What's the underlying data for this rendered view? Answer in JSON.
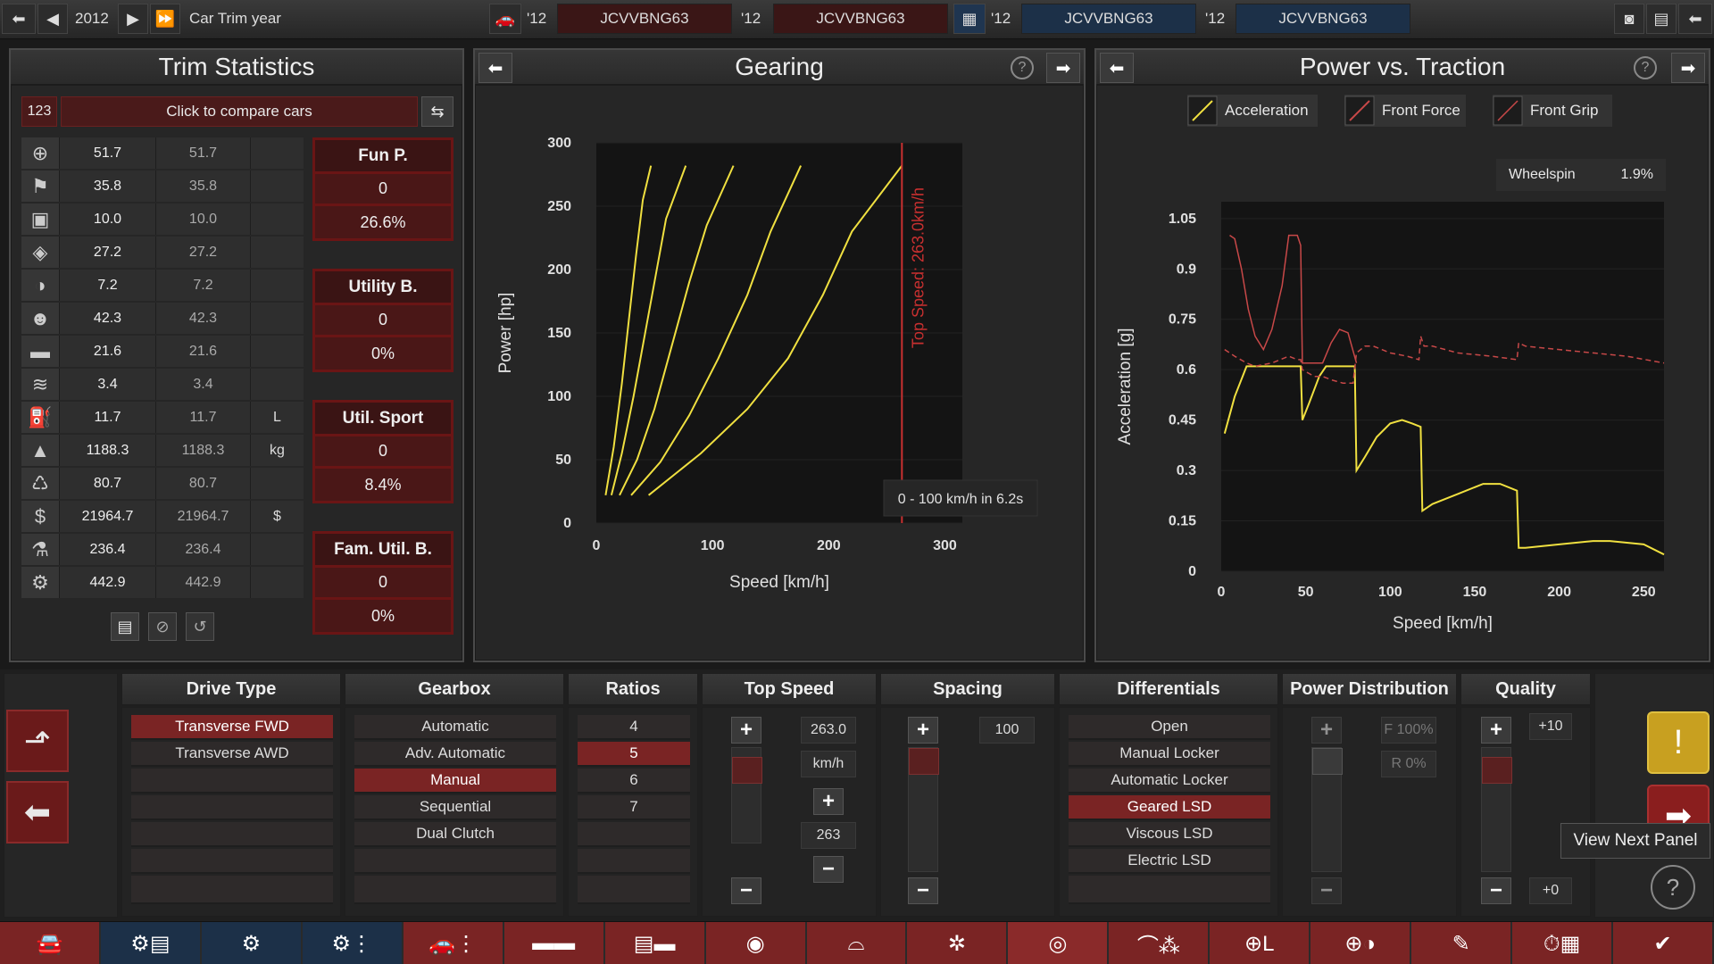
{
  "topbar": {
    "year": "2012",
    "trim_label": "Car Trim year",
    "cars": [
      {
        "year": "'12",
        "name": "JCVVBNG63"
      },
      {
        "year": "'12",
        "name": "JCVVBNG63"
      },
      {
        "year": "'12",
        "name": "JCVVBNG63"
      },
      {
        "year": "'12",
        "name": "JCVVBNG63"
      }
    ]
  },
  "trim_stats": {
    "title": "Trim Statistics",
    "id_label": "123",
    "compare_label": "Click to compare cars",
    "rows": [
      {
        "icon": "steering-wheel-icon",
        "glyph": "⊕",
        "v1": "51.7",
        "v2": "51.7",
        "unit": ""
      },
      {
        "icon": "race-flag-icon",
        "glyph": "⚑",
        "v1": "35.8",
        "v2": "35.8",
        "unit": ""
      },
      {
        "icon": "seat-icon",
        "glyph": "▣",
        "v1": "10.0",
        "v2": "10.0",
        "unit": ""
      },
      {
        "icon": "shield-icon",
        "glyph": "◈",
        "v1": "27.2",
        "v2": "27.2",
        "unit": ""
      },
      {
        "icon": "prestige-icon",
        "glyph": "◑",
        "v1": "7.2",
        "v2": "7.2",
        "unit": ""
      },
      {
        "icon": "passengers-icon",
        "glyph": "☻",
        "v1": "42.3",
        "v2": "42.3",
        "unit": ""
      },
      {
        "icon": "cargo-icon",
        "glyph": "▬",
        "v1": "21.6",
        "v2": "21.6",
        "unit": ""
      },
      {
        "icon": "offroad-icon",
        "glyph": "≋",
        "v1": "3.4",
        "v2": "3.4",
        "unit": ""
      },
      {
        "icon": "fuel-icon",
        "glyph": "⛽",
        "v1": "11.7",
        "v2": "11.7",
        "unit": "L"
      },
      {
        "icon": "weight-icon",
        "glyph": "▲",
        "v1": "1188.3",
        "v2": "1188.3",
        "unit": "kg"
      },
      {
        "icon": "service-icon",
        "glyph": "♺",
        "v1": "80.7",
        "v2": "80.7",
        "unit": ""
      },
      {
        "icon": "cost-icon",
        "glyph": "$",
        "v1": "21964.7",
        "v2": "21964.7",
        "unit": "$"
      },
      {
        "icon": "engineering-icon",
        "glyph": "⚗",
        "v1": "236.4",
        "v2": "236.4",
        "unit": ""
      },
      {
        "icon": "production-icon",
        "glyph": "⚙",
        "v1": "442.9",
        "v2": "442.9",
        "unit": ""
      }
    ],
    "scores": [
      {
        "title": "Fun P.",
        "value": "0",
        "percent": "26.6%"
      },
      {
        "title": "Utility B.",
        "value": "0",
        "percent": "0%"
      },
      {
        "title": "Util. Sport",
        "value": "0",
        "percent": "8.4%"
      },
      {
        "title": "Fam. Util. B.",
        "value": "0",
        "percent": "0%"
      }
    ]
  },
  "gearing": {
    "title": "Gearing",
    "ylabel": "Power [hp]",
    "xlabel": "Speed [km/h]",
    "yticks": [
      "0",
      "50",
      "100",
      "150",
      "200",
      "250",
      "300"
    ],
    "xticks": [
      "0",
      "100",
      "200",
      "300"
    ],
    "top_speed_label": "Top Speed: 263.0km/h",
    "accel_label": "0 - 100 km/h in 6.2s"
  },
  "traction": {
    "title": "Power vs. Traction",
    "legend": [
      "Acceleration",
      "Front Force",
      "Front Grip"
    ],
    "wheelspin_label": "Wheelspin",
    "wheelspin_value": "1.9%",
    "ylabel": "Acceleration [g]",
    "xlabel": "Speed [km/h]",
    "yticks": [
      "0",
      "0.15",
      "0.3",
      "0.45",
      "0.6",
      "0.75",
      "0.9",
      "1.05"
    ],
    "xticks": [
      "0",
      "50",
      "100",
      "150",
      "200",
      "250"
    ]
  },
  "chart_data": [
    {
      "type": "line",
      "title": "Gearing",
      "xlabel": "Speed [km/h]",
      "ylabel": "Power [hp]",
      "xlim": [
        0,
        315
      ],
      "ylim": [
        0,
        300
      ],
      "series": [
        {
          "x": [
            8,
            15,
            22,
            28,
            34,
            40,
            47
          ],
          "y": [
            22,
            60,
            110,
            160,
            210,
            255,
            282
          ]
        },
        {
          "x": [
            13,
            22,
            32,
            42,
            52,
            60,
            77
          ],
          "y": [
            22,
            55,
            100,
            150,
            200,
            240,
            282
          ]
        },
        {
          "x": [
            20,
            35,
            50,
            65,
            80,
            95,
            118
          ],
          "y": [
            22,
            50,
            90,
            140,
            190,
            235,
            282
          ]
        },
        {
          "x": [
            30,
            55,
            80,
            105,
            130,
            150,
            176
          ],
          "y": [
            22,
            48,
            85,
            130,
            180,
            230,
            282
          ]
        },
        {
          "x": [
            45,
            90,
            130,
            165,
            195,
            220,
            263
          ],
          "y": [
            22,
            55,
            90,
            130,
            180,
            230,
            282
          ]
        }
      ],
      "markers": [
        {
          "type": "vline",
          "x": 263
        }
      ]
    },
    {
      "type": "line",
      "title": "Power vs. Traction",
      "xlabel": "Speed [km/h]",
      "ylabel": "Acceleration [g]",
      "xlim": [
        0,
        262
      ],
      "ylim": [
        0,
        1.1
      ],
      "series": [
        {
          "name": "Acceleration",
          "x": [
            2,
            8,
            15,
            45,
            47,
            48,
            52,
            58,
            62,
            78,
            79,
            80,
            85,
            92,
            100,
            107,
            113,
            118,
            119,
            125,
            140,
            155,
            165,
            175,
            176,
            180,
            200,
            220,
            230,
            250,
            262
          ],
          "y": [
            0.41,
            0.52,
            0.61,
            0.61,
            0.61,
            0.45,
            0.5,
            0.58,
            0.61,
            0.61,
            0.61,
            0.3,
            0.34,
            0.4,
            0.44,
            0.45,
            0.44,
            0.43,
            0.18,
            0.2,
            0.23,
            0.26,
            0.26,
            0.24,
            0.07,
            0.07,
            0.08,
            0.09,
            0.09,
            0.08,
            0.05
          ]
        },
        {
          "name": "Front Force",
          "x": [
            2,
            8,
            15,
            20,
            25,
            30,
            40,
            45,
            47,
            48,
            55,
            60,
            65,
            72,
            78,
            80,
            85,
            90,
            100,
            110,
            117,
            118,
            120,
            125,
            140,
            160,
            175,
            176,
            180,
            200,
            220,
            240,
            262
          ],
          "y": [
            0.66,
            0.64,
            0.62,
            0.61,
            0.615,
            0.62,
            0.64,
            0.63,
            0.63,
            0.6,
            0.58,
            0.58,
            0.57,
            0.56,
            0.56,
            0.65,
            0.67,
            0.67,
            0.65,
            0.64,
            0.63,
            0.7,
            0.67,
            0.67,
            0.65,
            0.64,
            0.63,
            0.68,
            0.67,
            0.66,
            0.65,
            0.64,
            0.62
          ]
        },
        {
          "name": "Front Grip",
          "x": [
            5,
            8,
            12,
            16,
            20,
            25,
            30,
            36,
            40,
            45,
            47,
            48,
            60,
            65,
            70,
            75,
            80
          ],
          "y": [
            1.0,
            0.99,
            0.9,
            0.78,
            0.7,
            0.66,
            0.72,
            0.85,
            1.0,
            1.0,
            0.97,
            0.62,
            0.62,
            0.68,
            0.72,
            0.71,
            0.62
          ]
        }
      ]
    }
  ],
  "bottom": {
    "headers": [
      "Drive Type",
      "Gearbox",
      "Ratios",
      "Top Speed",
      "Spacing",
      "Differentials",
      "Power Distribution",
      "Quality"
    ],
    "drive_types": [
      "Transverse FWD",
      "Transverse AWD"
    ],
    "gearboxes": [
      "Automatic",
      "Adv. Automatic",
      "Manual",
      "Sequential",
      "Dual Clutch"
    ],
    "ratios": [
      "4",
      "5",
      "6",
      "7"
    ],
    "top_speed": {
      "value": "263.0",
      "unit": "km/h",
      "target": "263"
    },
    "spacing": {
      "value": "100"
    },
    "differentials": [
      "Open",
      "Manual Locker",
      "Automatic Locker",
      "Geared LSD",
      "Viscous LSD",
      "Electric LSD"
    ],
    "power_distribution": {
      "front": "F 100%",
      "rear": "R 0%"
    },
    "quality": {
      "top": "+10",
      "bottom": "+0"
    },
    "tooltip": "View Next Panel"
  },
  "nav": {
    "tabs": [
      "car-body-icon",
      "engine-parts-icon",
      "engine-icon",
      "engine-tune-icon",
      "car-trim-icon",
      "chassis-icon",
      "interior-icon",
      "headlight-icon",
      "gearbox-icon",
      "brakes-icon",
      "tyres-icon",
      "aero-icon",
      "handling-icon",
      "safety-icon",
      "fixtures-icon",
      "test-track-icon",
      "finish-icon"
    ]
  },
  "colors": {
    "accent_red": "#7a2424",
    "accel_line": "#f0e040",
    "force_line": "#c84848",
    "grip_line": "#c84848"
  }
}
